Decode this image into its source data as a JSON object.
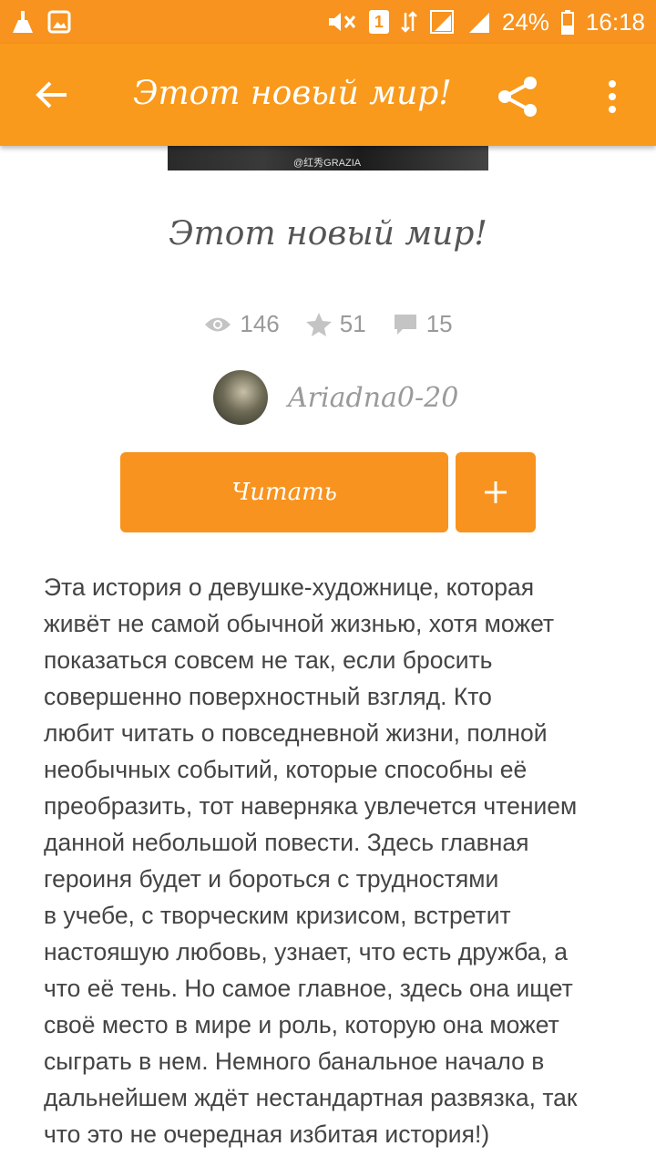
{
  "status_bar": {
    "battery": "24%",
    "time": "16:18",
    "sim_badge": "1",
    "icons": [
      "cleaner-icon",
      "gallery-icon",
      "mute-icon",
      "sim-icon",
      "data-icon",
      "signal-icon",
      "signal-icon",
      "battery-icon"
    ]
  },
  "app_bar": {
    "title": "Этот новый мир!",
    "icons": [
      "back-arrow-icon",
      "share-icon",
      "more-icon"
    ]
  },
  "cover": {
    "watermark": "@红秀GRAZIA"
  },
  "book": {
    "title": "Этот новый мир!",
    "views": "146",
    "rating": "51",
    "comments": "15"
  },
  "author": {
    "name": "Ariadna0-20"
  },
  "actions": {
    "read_label": "Читать",
    "add_label": "+"
  },
  "description": "Эта история о девушке-художнице, которая\nживёт не самой обычной жизнью, хотя может\nпоказаться совсем не так, если бросить\nсовершенно поверхностный взгляд. Кто\nлюбит читать о повседневной жизни, полной\nнеобычных событий, которые способны её\nпреобразить, тот наверняка увлечется чтением\nданной небольшой повести. Здесь главная\nгероиня будет и бороться с трудностями\nв учебе, с творческим кризисом, встретит\nнастояшую любовь, узнает, что есть дружба, а\nчто её тень. Но самое главное, здесь она ищет\nсвоё место в мире и роль, которую она может\nсыграть в нем. Немного банальное начало в\nдальнейшем ждёт нестандартная развязка, так\nчто это не очередная избитая история!)",
  "colors": {
    "accent": "#F7931E",
    "text": "#444444",
    "muted": "#9A9A9A"
  }
}
